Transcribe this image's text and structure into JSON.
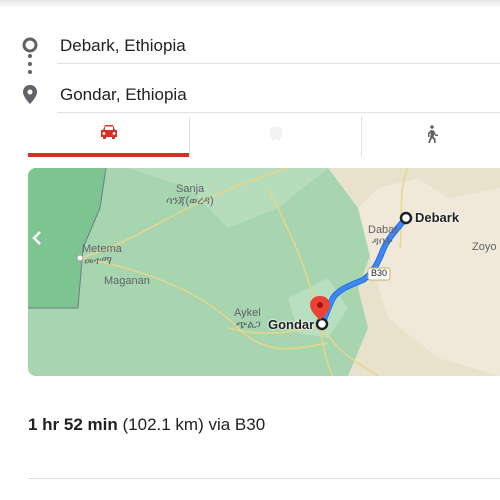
{
  "directions": {
    "origin": "Debark, Ethiopia",
    "destination": "Gondar, Ethiopia"
  },
  "modes": [
    {
      "name": "driving",
      "icon": "car-icon",
      "active": true
    },
    {
      "name": "transit",
      "icon": "transit-icon",
      "active": false
    },
    {
      "name": "walking",
      "icon": "walking-icon",
      "active": false
    }
  ],
  "map": {
    "places": {
      "sanja": "Sanja",
      "sanja_amharic": "ሳንጃ(ወረዳ)",
      "metema": "Metema",
      "metema_amharic": "መተማ",
      "maganan": "Maganan",
      "aykel": "Aykel",
      "aykel_amharic": "ጭልጋ",
      "dabat": "Dabat",
      "dabat_amharic": "ዳባት",
      "zoyo": "Zoyo",
      "road_label": "B30"
    },
    "endpoints": {
      "origin": "Debark",
      "destination": "Gondar"
    },
    "colors": {
      "route": "#4285f4",
      "pin": "#ea4335",
      "active_tab": "#d93025"
    }
  },
  "summary": {
    "duration": "1 hr 52 min",
    "distance": "(102.1 km) via B30"
  }
}
